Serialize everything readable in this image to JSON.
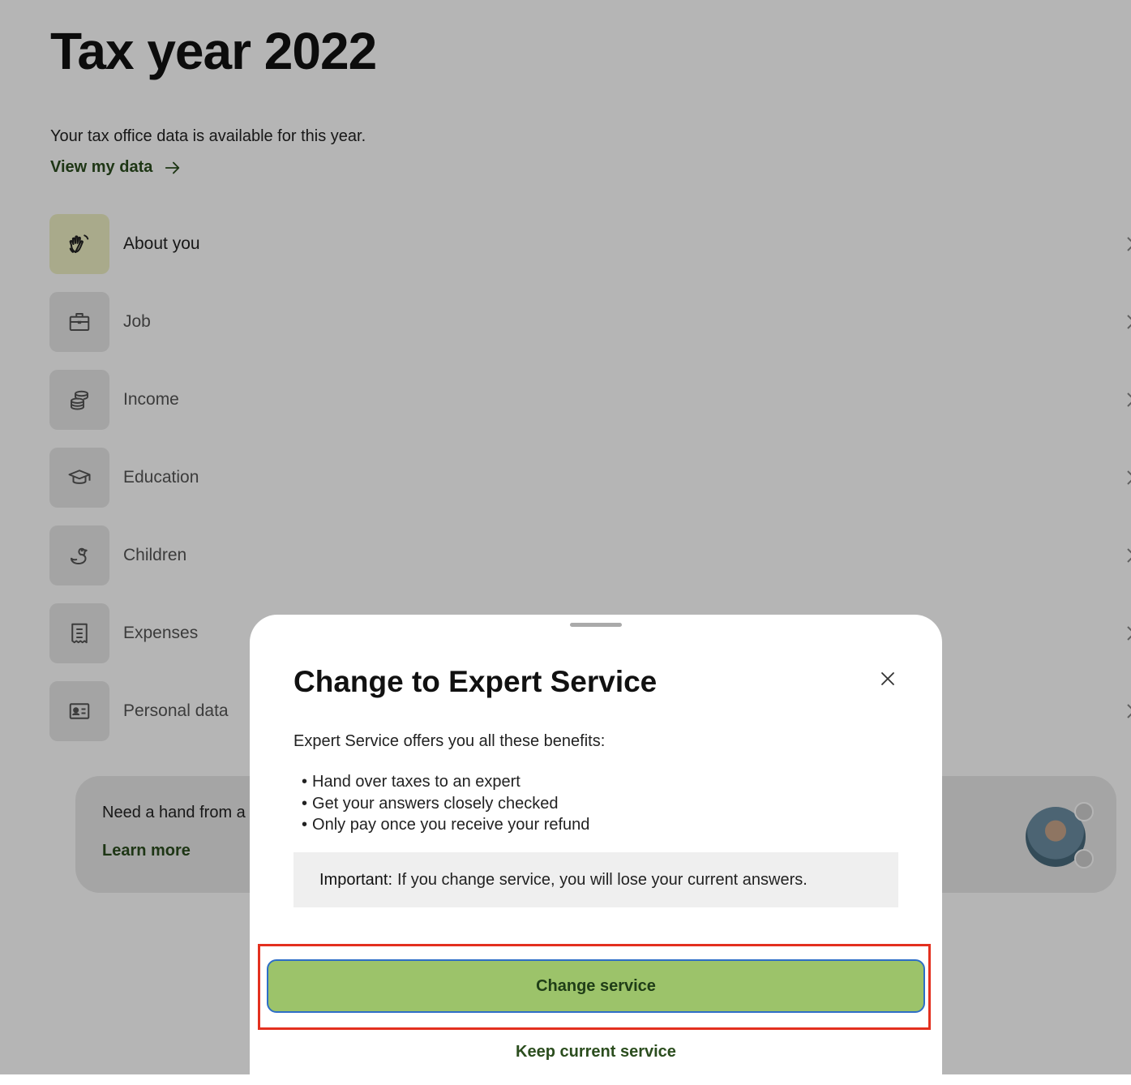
{
  "page": {
    "title": "Tax year 2022",
    "subtitle": "Your tax office data is available for this year.",
    "view_data_link": "View my data"
  },
  "categories": [
    {
      "label": "About you",
      "icon": "waving-hand-icon"
    },
    {
      "label": "Job",
      "icon": "briefcase-icon"
    },
    {
      "label": "Income",
      "icon": "coins-icon"
    },
    {
      "label": "Education",
      "icon": "graduation-cap-icon"
    },
    {
      "label": "Children",
      "icon": "rubber-duck-icon"
    },
    {
      "label": "Expenses",
      "icon": "receipt-icon"
    },
    {
      "label": "Personal data",
      "icon": "id-card-icon"
    }
  ],
  "help_card": {
    "text": "Need a hand from a",
    "link": "Learn more"
  },
  "modal": {
    "title": "Change to Expert Service",
    "intro": "Expert Service offers you all these benefits:",
    "benefits": [
      "Hand over taxes to an expert",
      "Get your answers closely checked",
      "Only pay once you receive your refund"
    ],
    "notice_label": "Important:",
    "notice_text": "If you change service, you will lose your current answers.",
    "primary_button": "Change service",
    "secondary_button": "Keep current service"
  },
  "colors": {
    "brand_green": "#9cc36a",
    "link_green": "#2b4d1e",
    "active_icon_bg": "#eef0c4",
    "highlight": "#e3301f"
  }
}
